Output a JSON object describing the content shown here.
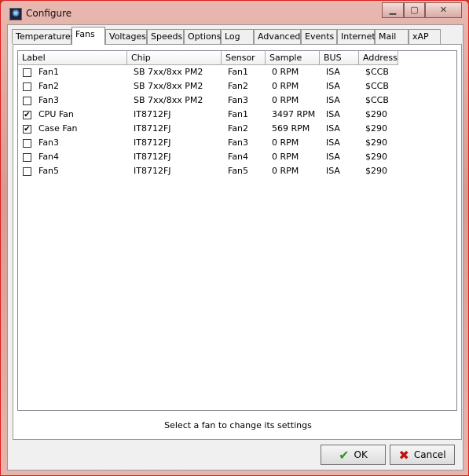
{
  "window": {
    "title": "Configure",
    "icon": "app-fan-icon",
    "controls": [
      "minimize",
      "maximize",
      "close"
    ]
  },
  "tabs": [
    {
      "label": "Temperatures"
    },
    {
      "label": "Fans",
      "active": true
    },
    {
      "label": "Voltages"
    },
    {
      "label": "Speeds"
    },
    {
      "label": "Options"
    },
    {
      "label": "Log"
    },
    {
      "label": "Advanced"
    },
    {
      "label": "Events"
    },
    {
      "label": "Internet"
    },
    {
      "label": "Mail"
    },
    {
      "label": "xAP"
    }
  ],
  "table": {
    "columns": [
      "Label",
      "Chip",
      "Sensor",
      "Sample",
      "BUS",
      "Address"
    ],
    "rows": [
      {
        "checked": false,
        "cells": [
          "Fan1",
          "SB 7xx/8xx PM2",
          "Fan1",
          "0 RPM",
          "ISA",
          "$CCB"
        ]
      },
      {
        "checked": false,
        "cells": [
          "Fan2",
          "SB 7xx/8xx PM2",
          "Fan2",
          "0 RPM",
          "ISA",
          "$CCB"
        ]
      },
      {
        "checked": false,
        "cells": [
          "Fan3",
          "SB 7xx/8xx PM2",
          "Fan3",
          "0 RPM",
          "ISA",
          "$CCB"
        ]
      },
      {
        "checked": true,
        "cells": [
          "CPU Fan",
          "IT8712FJ",
          "Fan1",
          "3497 RPM",
          "ISA",
          "$290"
        ]
      },
      {
        "checked": true,
        "cells": [
          "Case Fan",
          "IT8712FJ",
          "Fan2",
          "569 RPM",
          "ISA",
          "$290"
        ]
      },
      {
        "checked": false,
        "cells": [
          "Fan3",
          "IT8712FJ",
          "Fan3",
          "0 RPM",
          "ISA",
          "$290"
        ]
      },
      {
        "checked": false,
        "cells": [
          "Fan4",
          "IT8712FJ",
          "Fan4",
          "0 RPM",
          "ISA",
          "$290"
        ]
      },
      {
        "checked": false,
        "cells": [
          "Fan5",
          "IT8712FJ",
          "Fan5",
          "0 RPM",
          "ISA",
          "$290"
        ]
      }
    ]
  },
  "status": "Select a fan to change its settings",
  "buttons": {
    "ok": "OK",
    "cancel": "Cancel"
  },
  "colors": {
    "ok_icon": "#2a9a1a",
    "cancel_icon": "#c01010"
  }
}
